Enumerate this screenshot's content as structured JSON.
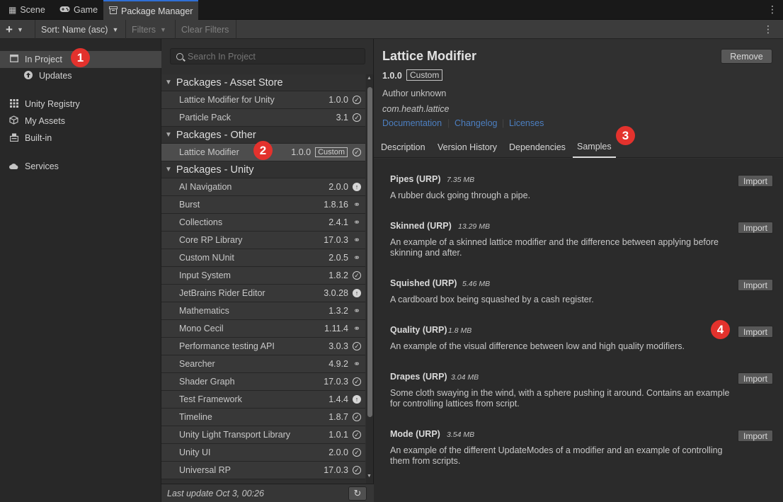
{
  "tabs": [
    {
      "label": "Scene",
      "icon": "grid-icon"
    },
    {
      "label": "Game",
      "icon": "gamepad-icon"
    },
    {
      "label": "Package Manager",
      "icon": "package-icon",
      "active": true
    }
  ],
  "toolbar": {
    "add_label": "+",
    "sort_label": "Sort: Name (asc)",
    "filters_label": "Filters",
    "clear_filters_label": "Clear Filters"
  },
  "nav": {
    "in_project": "In Project",
    "updates": "Updates",
    "unity_registry": "Unity Registry",
    "my_assets": "My Assets",
    "built_in": "Built-in",
    "services": "Services"
  },
  "search": {
    "placeholder": "Search In Project"
  },
  "groups": {
    "asset_store": "Packages - Asset Store",
    "other": "Packages - Other",
    "unity": "Packages - Unity"
  },
  "packages": {
    "asset_store": [
      {
        "name": "Lattice Modifier for Unity",
        "version": "1.0.0",
        "status": "installed"
      },
      {
        "name": "Particle Pack",
        "version": "3.1",
        "status": "installed"
      }
    ],
    "other": [
      {
        "name": "Lattice Modifier",
        "version": "1.0.0",
        "badge": "Custom",
        "status": "installed",
        "selected": true
      }
    ],
    "unity": [
      {
        "name": "AI Navigation",
        "version": "2.0.0",
        "status": "update"
      },
      {
        "name": "Burst",
        "version": "1.8.16",
        "status": "dependency"
      },
      {
        "name": "Collections",
        "version": "2.4.1",
        "status": "dependency"
      },
      {
        "name": "Core RP Library",
        "version": "17.0.3",
        "status": "dependency"
      },
      {
        "name": "Custom NUnit",
        "version": "2.0.5",
        "status": "dependency"
      },
      {
        "name": "Input System",
        "version": "1.8.2",
        "status": "installed"
      },
      {
        "name": "JetBrains Rider Editor",
        "version": "3.0.28",
        "status": "update"
      },
      {
        "name": "Mathematics",
        "version": "1.3.2",
        "status": "dependency"
      },
      {
        "name": "Mono Cecil",
        "version": "1.11.4",
        "status": "dependency"
      },
      {
        "name": "Performance testing API",
        "version": "3.0.3",
        "status": "installed"
      },
      {
        "name": "Searcher",
        "version": "4.9.2",
        "status": "dependency"
      },
      {
        "name": "Shader Graph",
        "version": "17.0.3",
        "status": "installed"
      },
      {
        "name": "Test Framework",
        "version": "1.4.4",
        "status": "update"
      },
      {
        "name": "Timeline",
        "version": "1.8.7",
        "status": "installed"
      },
      {
        "name": "Unity Light Transport Library",
        "version": "1.0.1",
        "status": "installed"
      },
      {
        "name": "Unity UI",
        "version": "2.0.0",
        "status": "installed"
      },
      {
        "name": "Universal RP",
        "version": "17.0.3",
        "status": "installed"
      }
    ]
  },
  "list_footer": {
    "last_update": "Last update Oct 3, 00:26"
  },
  "details": {
    "title": "Lattice Modifier",
    "remove_label": "Remove",
    "version": "1.0.0",
    "badge": "Custom",
    "author": "Author unknown",
    "package_id": "com.heath.lattice",
    "links": [
      "Documentation",
      "Changelog",
      "Licenses"
    ],
    "tabs": [
      "Description",
      "Version History",
      "Dependencies",
      "Samples"
    ],
    "active_tab": "Samples",
    "import_label": "Import",
    "samples": [
      {
        "name": "Pipes (URP)",
        "size": "7.35 MB",
        "desc": "A rubber duck going through a pipe."
      },
      {
        "name": "Skinned (URP)",
        "size": "13.29 MB",
        "desc": "An example of a skinned lattice modifier and the difference between applying before skinning and after."
      },
      {
        "name": "Squished (URP)",
        "size": "5.46 MB",
        "desc": "A cardboard box being squashed by a cash register."
      },
      {
        "name": "Quality (URP)",
        "size": "1.8 MB",
        "desc": "An example of the visual difference between low and high quality modifiers."
      },
      {
        "name": "Drapes (URP)",
        "size": "3.04 MB",
        "desc": "Some cloth swaying in the wind, with a sphere pushing it around. Contains an example for controlling lattices from script."
      },
      {
        "name": "Mode (URP)",
        "size": "3.54 MB",
        "desc": "An example of the different UpdateModes of a modifier and an example of controlling them from scripts."
      }
    ]
  },
  "callouts": [
    "1",
    "2",
    "3",
    "4"
  ],
  "colors": {
    "callout": "#e3322d",
    "link": "#4c7fc1",
    "active_tab_border": "#2f6fd6"
  }
}
